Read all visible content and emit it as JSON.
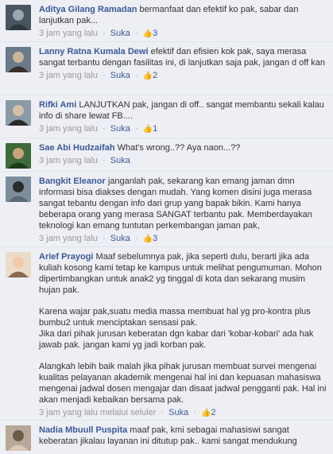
{
  "comments": [
    {
      "author": "Aditya Gilang Ramadan",
      "text": "bermanfaat dan efektif ko pak, sabar dan lanjutkan pak...",
      "time": "3 jam yang lalu",
      "like_label": "Suka",
      "likes": "3",
      "avatar_colors": [
        "#4a5560",
        "#9aa6b0",
        "#2e3740"
      ]
    },
    {
      "author": "Lanny Ratna Kumala Dewi",
      "text": "efektif dan efisien kok pak, saya merasa sangat terbantu dengan fasilitas ini, di lanjutkan saja pak, jangan d off kan",
      "time": "3 jam yang lalu",
      "like_label": "Suka",
      "likes": "2",
      "avatar_colors": [
        "#6a7a8a",
        "#c8b59a",
        "#3a2f2a"
      ]
    },
    {
      "author": "Rifki Ami",
      "text": "LANJUTKAN pak, jangan di off.. sangat membantu sekali kalau info di share lewat FB....",
      "time": "3 jam yang lalu",
      "like_label": "Suka",
      "likes": "1",
      "avatar_colors": [
        "#8a9aa6",
        "#d4c0a8",
        "#2a2a2a"
      ]
    },
    {
      "author": "Sae Abi Hudzaifah",
      "text": "What's wrong..?? Aya naon...??",
      "time": "3 jam yang lalu",
      "like_label": "Suka",
      "likes": "",
      "avatar_colors": [
        "#3d6b3a",
        "#c9a27c",
        "#1e3a1c"
      ]
    },
    {
      "author": "Bangkit Eleanor",
      "text": "janganlah pak, sekarang kan emang jaman dmn informasi bisa diakses dengan mudah. Yang komen disini juga merasa sangat tebantu dengan info dari grup yang bapak bikin. Kami hanya beberapa orang yang merasa SANGAT terbantu pak. Memberdayakan teknologi kan emang tuntutan perkembangan jaman pak,",
      "time": "3 jam yang lalu",
      "like_label": "Suka",
      "likes": "3",
      "avatar_colors": [
        "#7c8e9c",
        "#2b2b2b",
        "#5a6a78"
      ]
    },
    {
      "author": "Arief Prayogi",
      "paragraphs": [
        "Maaf sebelumnya pak, jika seperti dulu, berarti jika ada kuliah kosong kami tetap ke kampus untuk melihat pengumuman. Mohon dipertimbangkan untuk anak2 yg tinggal di kota dan sekarang musim hujan pak.",
        "Karena wajar pak,suatu media massa membuat hal yg pro-kontra plus bumbu2 untuk menciptakan sensasi pak.\nJika dari pihak jurusan keberatan dgn kabar dari 'kobar-kobari' ada hak jawab pak. jangan kami yg jadi korban pak.",
        "Alangkah lebih baik malah jika pihak jurusan membuat survei mengenai kualitas pelayanan akademik mengenai hal ini dan kepuasan mahasiswa mengenai jadwal dosen mengajar dan disaat jadwal pengganti pak. Hal ini akan menjadi kebaikan bersama pak."
      ],
      "time": "3 jam yang lalu melalui seluler",
      "like_label": "Suka",
      "likes": "2",
      "avatar_colors": [
        "#e9dcc9",
        "#f1c9a8",
        "#8a6a52"
      ]
    },
    {
      "author": "Nadia Mbuull Puspita",
      "text": "maaf pak, kmi sebagai mahasiswi sangat keberatan jikalau layanan ini ditutup pak.. kami sangat mendukung",
      "time": "",
      "like_label": "",
      "likes": "",
      "avatar_colors": [
        "#b8a898",
        "#6a5a4a",
        "#d8c8b8"
      ]
    }
  ],
  "meta": {
    "separator": "·",
    "like_icon": "thumbs-up-icon",
    "link_color": "#3b5998",
    "muted_color": "#999999",
    "comment_bg": "#edeff4"
  }
}
